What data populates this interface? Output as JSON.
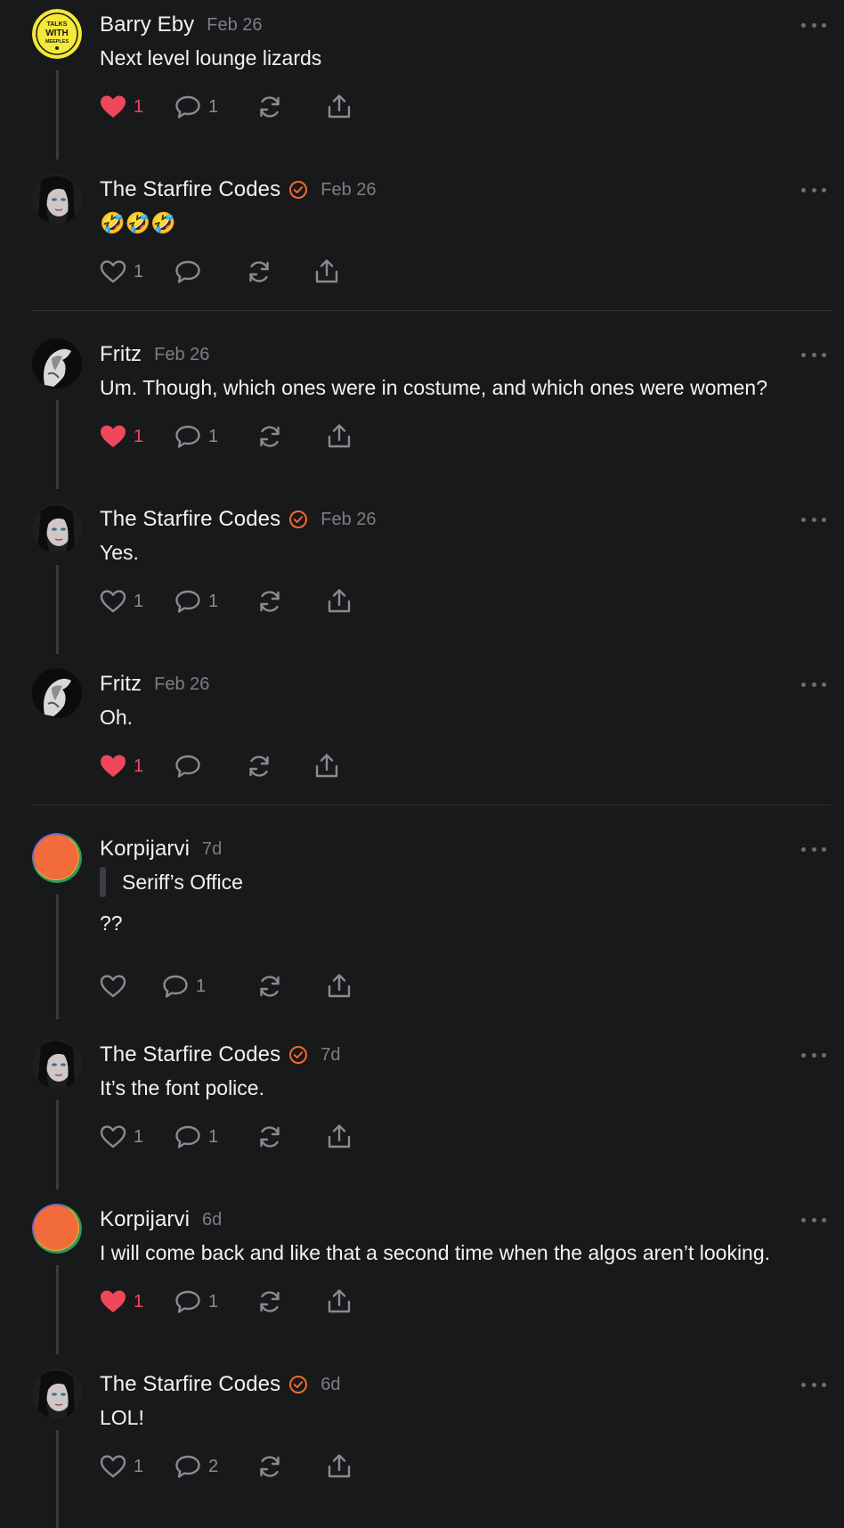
{
  "colors": {
    "background": "#18191b",
    "text": "#f2f2f3",
    "muted": "#7d7e82",
    "liked": "#f0475a",
    "verified": "#f06a2e"
  },
  "icons": {
    "like": "heart-icon",
    "reply": "comment-bubble-icon",
    "repost": "repost-icon",
    "share": "share-icon",
    "more": "more-dots-icon",
    "verified": "verified-badge-icon"
  },
  "posts": [
    {
      "author": "Barry Eby",
      "date": "Feb 26",
      "verified": false,
      "text": "Next level lounge lizards",
      "likes": "1",
      "liked": true,
      "replies": "1"
    },
    {
      "author": "The Starfire Codes",
      "date": "Feb 26",
      "verified": true,
      "text": "🤣🤣🤣",
      "likes": "1",
      "liked": false,
      "replies": ""
    },
    {
      "author": "Fritz",
      "date": "Feb 26",
      "verified": false,
      "text": "Um. Though, which ones were in costume, and which ones were women?",
      "likes": "1",
      "liked": true,
      "replies": "1"
    },
    {
      "author": "The Starfire Codes",
      "date": "Feb 26",
      "verified": true,
      "text": "Yes.",
      "likes": "1",
      "liked": false,
      "replies": "1"
    },
    {
      "author": "Fritz",
      "date": "Feb 26",
      "verified": false,
      "text": "Oh.",
      "likes": "1",
      "liked": true,
      "replies": ""
    },
    {
      "author": "Korpijarvi",
      "date": "7d",
      "verified": false,
      "quote": "Seriff’s Office",
      "text": "??",
      "likes": "",
      "liked": false,
      "replies": "1"
    },
    {
      "author": "The Starfire Codes",
      "date": "7d",
      "verified": true,
      "text": "It’s the font police.",
      "likes": "1",
      "liked": false,
      "replies": "1"
    },
    {
      "author": "Korpijarvi",
      "date": "6d",
      "verified": false,
      "text": "I will come back and like that a second time when the algos aren’t looking.",
      "likes": "1",
      "liked": true,
      "replies": "1"
    },
    {
      "author": "The Starfire Codes",
      "date": "6d",
      "verified": true,
      "text": "LOL!",
      "likes": "1",
      "liked": false,
      "replies": "2"
    }
  ],
  "avatars": {
    "barry_badge_text": [
      "TALKS",
      "WITH",
      "MEEPLES"
    ]
  }
}
